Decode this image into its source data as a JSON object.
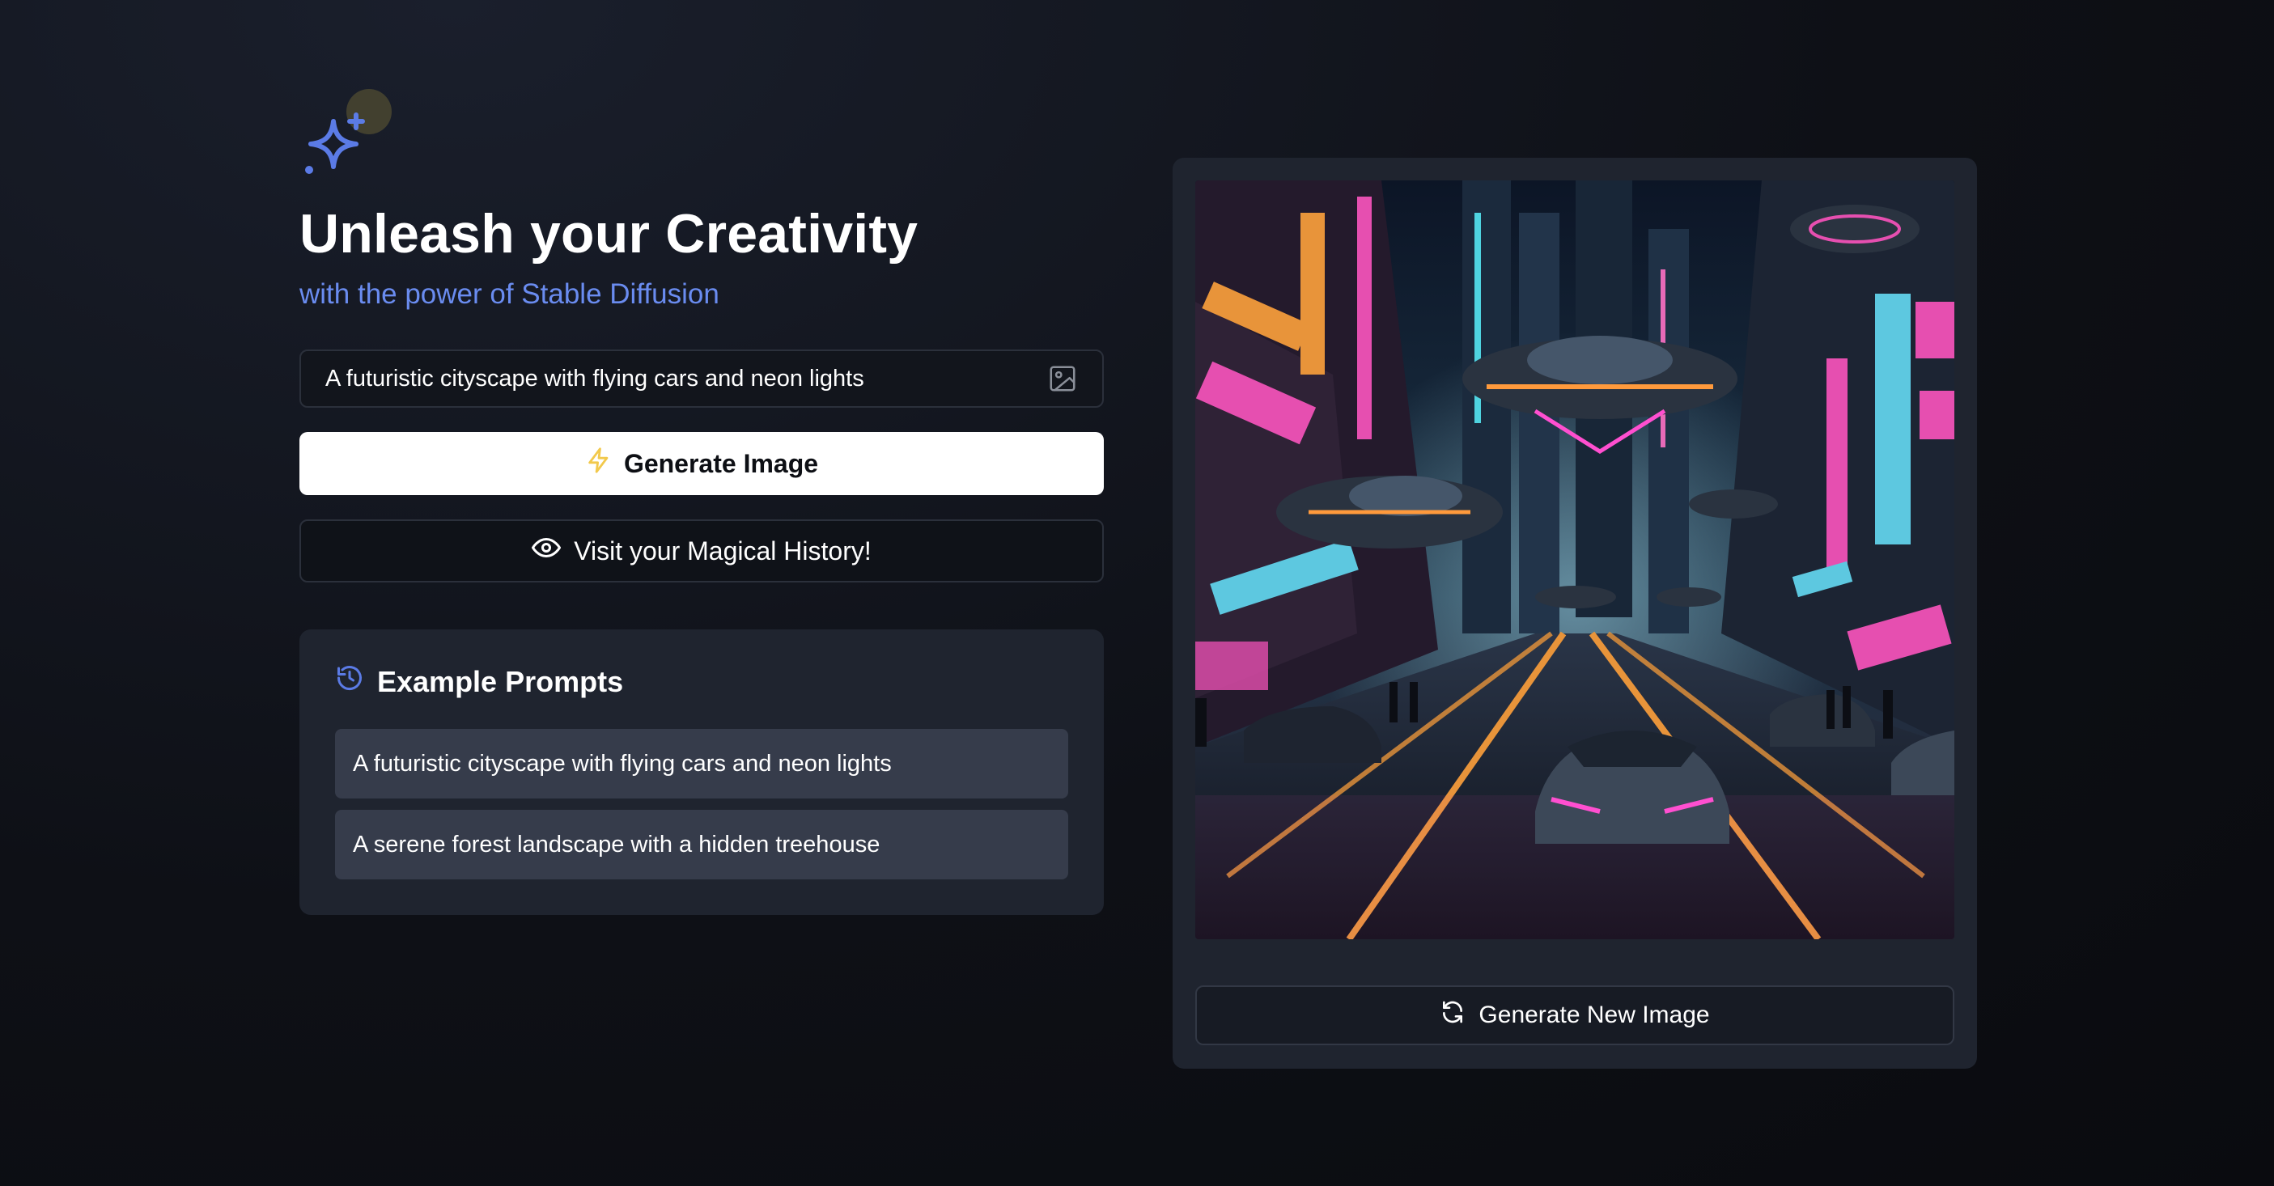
{
  "app": {
    "title": "Unleash your Creativity",
    "subtitle": "with the power of Stable Diffusion",
    "logo_icon": "sparkles-icon"
  },
  "prompt": {
    "value": "A futuristic cityscape with flying cars and neon lights",
    "icon": "image-icon"
  },
  "actions": {
    "generate_label": "Generate Image",
    "generate_icon": "lightning-icon",
    "history_label": "Visit your Magical History!",
    "history_icon": "eye-icon"
  },
  "examples": {
    "heading": "Example Prompts",
    "icon": "history-icon",
    "items": [
      "A futuristic cityscape with flying cars and neon lights",
      "A serene forest landscape with a hidden treehouse"
    ]
  },
  "result": {
    "image_subject": "futuristic neon city street with flying cars",
    "regenerate_label": "Generate New Image",
    "regenerate_icon": "refresh-icon"
  },
  "colors": {
    "accent": "#6a8cf0",
    "lightning": "#f2c94c",
    "panel": "#1f242f",
    "background": "#0e1016"
  }
}
